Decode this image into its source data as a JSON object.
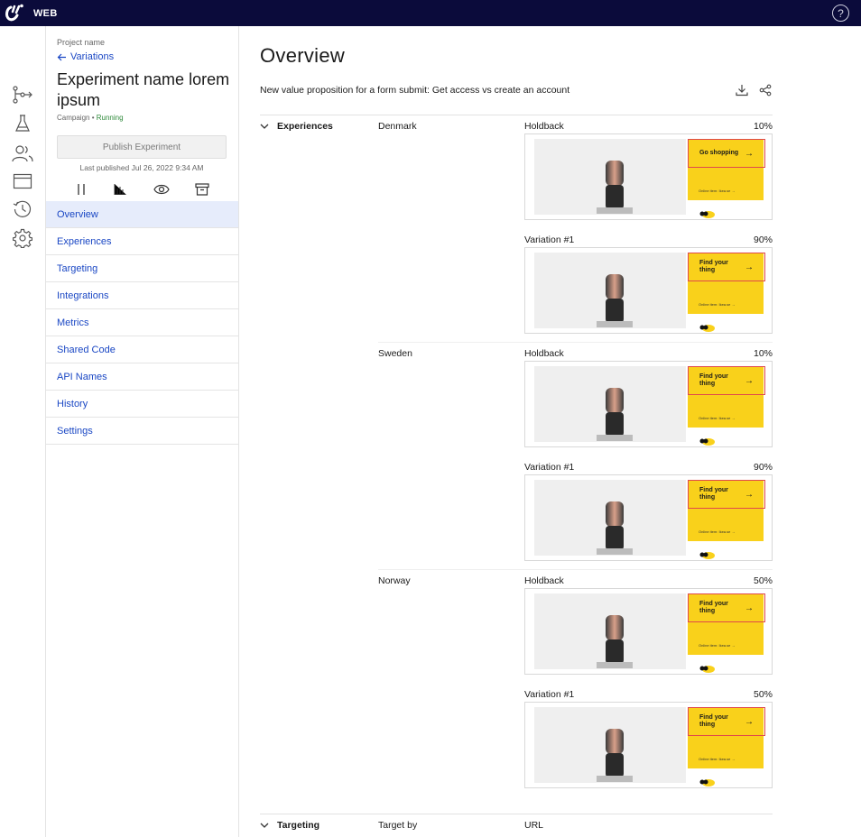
{
  "topbar": {
    "app_name": "WEB",
    "help_glyph": "?"
  },
  "rail": {
    "icons": [
      "flow-icon",
      "flask-icon",
      "users-icon",
      "browser-window-icon",
      "history-icon",
      "gear-icon"
    ]
  },
  "panel": {
    "project_label": "Project name",
    "back_label": "Variations",
    "experiment_title": "Experiment name lorem ipsum",
    "campaign_label": "Campaign",
    "status_label": "Running",
    "publish_label": "Publish Experiment",
    "last_published": "Last published Jul 26, 2022 9:34 AM",
    "nav": [
      "Overview",
      "Experiences",
      "Targeting",
      "Integrations",
      "Metrics",
      "Shared Code",
      "API Names",
      "History",
      "Settings"
    ],
    "active_nav": "Overview"
  },
  "main": {
    "title": "Overview",
    "subtitle": "New value proposition for a form submit: Get access vs create an account",
    "experiences_label": "Experiences",
    "targeting_label": "Targeting",
    "target_by_label": "Target by",
    "target_by_value": "URL",
    "countries": [
      {
        "name": "Denmark",
        "variations": [
          {
            "name": "Holdback",
            "pct": "10%",
            "cta": "Go shopping"
          },
          {
            "name": "Variation #1",
            "pct": "90%",
            "cta": "Find your thing"
          }
        ]
      },
      {
        "name": "Sweden",
        "variations": [
          {
            "name": "Holdback",
            "pct": "10%",
            "cta": "Find your thing"
          },
          {
            "name": "Variation #1",
            "pct": "90%",
            "cta": "Find your thing"
          }
        ]
      },
      {
        "name": "Norway",
        "variations": [
          {
            "name": "Holdback",
            "pct": "50%",
            "cta": "Find your thing"
          },
          {
            "name": "Variation #1",
            "pct": "50%",
            "cta": "Find your thing"
          }
        ]
      }
    ],
    "preview_footer": "Online item: Ikea.se  →"
  },
  "colors": {
    "topbar": "#0b0b3b",
    "link": "#1a47c4",
    "running": "#2f8a3b",
    "active_nav": "#e6ecfb",
    "banner": "#f9d11b",
    "highlight": "#e0484b"
  }
}
